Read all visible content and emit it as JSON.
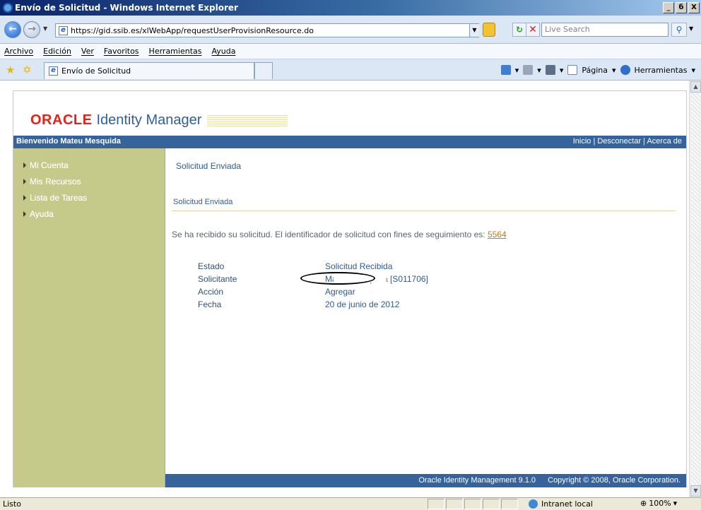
{
  "window": {
    "title": "Envío de Solicitud - Windows Internet Explorer",
    "buttons": [
      "_",
      "б",
      "X"
    ]
  },
  "address_bar": {
    "url": "https://gid.ssib.es/xlWebApp/requestUserProvisionResource.do",
    "search_placeholder": "Live Search"
  },
  "menu": {
    "items": [
      "Archivo",
      "Edición",
      "Ver",
      "Favoritos",
      "Herramientas",
      "Ayuda"
    ]
  },
  "tabs": {
    "active_tab": "Envío de Solicitud"
  },
  "command_bar": {
    "page_label": "Página",
    "tools_label": "Herramientas"
  },
  "app": {
    "logo_oracle": "ORACLE",
    "logo_product": "Identity Manager",
    "welcome": "Bienvenido Mateu Mesquida",
    "top_links": "Inicio | Desconectar | Acerca de",
    "nav": [
      {
        "label": "Mi Cuenta"
      },
      {
        "label": "Mis Recursos"
      },
      {
        "label": "Lista de Tareas"
      },
      {
        "label": "Ayuda"
      }
    ],
    "page_title": "Solicitud Enviada",
    "section_title": "Solicitud Enviada",
    "message": "Se ha recibido su solicitud. El identificador de solicitud con fines de seguimiento es:",
    "request_id": "5564",
    "details": [
      {
        "key": "Estado",
        "value": "Solicitud Recibida"
      },
      {
        "key": "Solicitante",
        "value": "Mateu Mesquida [S011706]"
      },
      {
        "key": "Acción",
        "value": "Agregar"
      },
      {
        "key": "Fecha",
        "value": "20 de junio de 2012"
      }
    ],
    "footer_version": "Oracle Identity Management 9.1.0",
    "footer_copyright": "Copyright © 2008, Oracle Corporation."
  },
  "status_bar": {
    "status": "Listo",
    "zone": "Intranet local",
    "zoom": "100%"
  }
}
